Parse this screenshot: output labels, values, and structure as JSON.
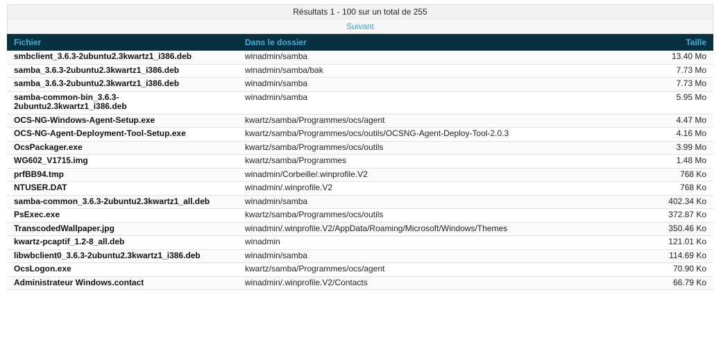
{
  "summary": "Résultats 1 - 100 sur un total de 255",
  "pager": {
    "next_label": "Suivant"
  },
  "columns": {
    "file": "Fichier",
    "folder": "Dans le dossier",
    "size": "Taille"
  },
  "rows": [
    {
      "file": "smbclient_3.6.3-2ubuntu2.3kwartz1_i386.deb",
      "folder": "winadmin/samba",
      "size": "13.40 Mo"
    },
    {
      "file": "samba_3.6.3-2ubuntu2.3kwartz1_i386.deb",
      "folder": "winadmin/samba/bak",
      "size": "7.73 Mo"
    },
    {
      "file": "samba_3.6.3-2ubuntu2.3kwartz1_i386.deb",
      "folder": "winadmin/samba",
      "size": "7.73 Mo"
    },
    {
      "file": "samba-common-bin_3.6.3-2ubuntu2.3kwartz1_i386.deb",
      "folder": "winadmin/samba",
      "size": "5.95 Mo"
    },
    {
      "file": "OCS-NG-Windows-Agent-Setup.exe",
      "folder": "kwartz/samba/Programmes/ocs/agent",
      "size": "4.47 Mo"
    },
    {
      "file": "OCS-NG-Agent-Deployment-Tool-Setup.exe",
      "folder": "kwartz/samba/Programmes/ocs/outils/OCSNG-Agent-Deploy-Tool-2.0.3",
      "size": "4.16 Mo"
    },
    {
      "file": "OcsPackager.exe",
      "folder": "kwartz/samba/Programmes/ocs/outils",
      "size": "3.99 Mo"
    },
    {
      "file": "WG602_V1715.img",
      "folder": "kwartz/samba/Programmes",
      "size": "1.48 Mo"
    },
    {
      "file": "prfBB94.tmp",
      "folder": "winadmin/Corbeille/.winprofile.V2",
      "size": "768 Ko"
    },
    {
      "file": "NTUSER.DAT",
      "folder": "winadmin/.winprofile.V2",
      "size": "768 Ko"
    },
    {
      "file": "samba-common_3.6.3-2ubuntu2.3kwartz1_all.deb",
      "folder": "winadmin/samba",
      "size": "402.34 Ko"
    },
    {
      "file": "PsExec.exe",
      "folder": "kwartz/samba/Programmes/ocs/outils",
      "size": "372.87 Ko"
    },
    {
      "file": "TranscodedWallpaper.jpg",
      "folder": "winadmin/.winprofile.V2/AppData/Roaming/Microsoft/Windows/Themes",
      "size": "350.46 Ko"
    },
    {
      "file": "kwartz-pcaptif_1.2-8_all.deb",
      "folder": "winadmin",
      "size": "121.01 Ko"
    },
    {
      "file": "libwbclient0_3.6.3-2ubuntu2.3kwartz1_i386.deb",
      "folder": "winadmin/samba",
      "size": "114.69 Ko"
    },
    {
      "file": "OcsLogon.exe",
      "folder": "kwartz/samba/Programmes/ocs/agent",
      "size": "70.90 Ko"
    },
    {
      "file": "Administrateur Windows.contact",
      "folder": "winadmin/.winprofile.V2/Contacts",
      "size": "66.79 Ko"
    }
  ]
}
